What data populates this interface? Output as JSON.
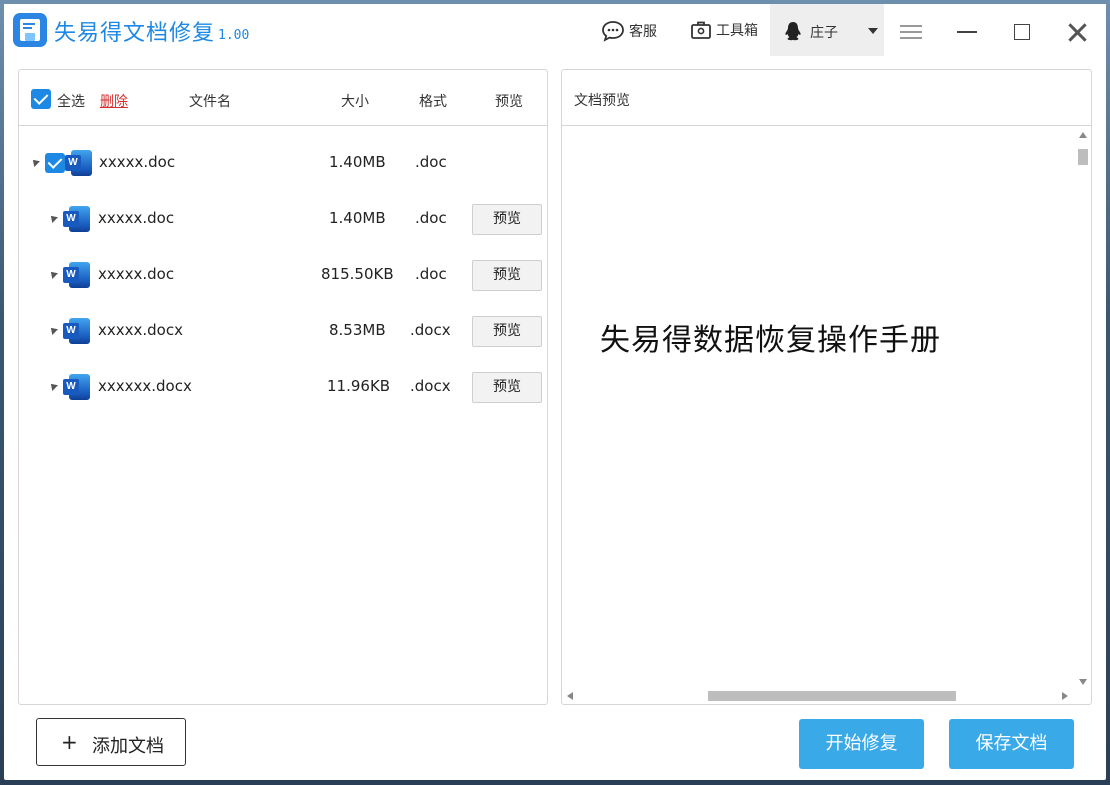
{
  "app": {
    "title": "失易得文档修复",
    "version": "1.00"
  },
  "titlebar": {
    "support_label": "客服",
    "toolbox_label": "工具箱",
    "user_name": "庄子"
  },
  "file_list": {
    "select_all_label": "全选",
    "delete_label": "删除",
    "columns": {
      "name": "文件名",
      "size": "大小",
      "format": "格式",
      "preview": "预览"
    },
    "rows": [
      {
        "name": "xxxxx.doc",
        "size": "1.40MB",
        "format": ".doc",
        "preview": "",
        "checked": true
      },
      {
        "name": "xxxxx.doc",
        "size": "1.40MB",
        "format": ".doc",
        "preview": "预览"
      },
      {
        "name": "xxxxx.doc",
        "size": "815.50KB",
        "format": ".doc",
        "preview": "预览"
      },
      {
        "name": "xxxxx.docx",
        "size": "8.53MB",
        "format": ".docx",
        "preview": "预览"
      },
      {
        "name": "xxxxxx.docx",
        "size": "11.96KB",
        "format": ".docx",
        "preview": "预览"
      }
    ]
  },
  "preview_panel": {
    "title": "文档预览",
    "document_heading": "失易得数据恢复操作手册"
  },
  "footer": {
    "add_button": "添加文档",
    "start_repair_button": "开始修复",
    "save_button": "保存文档"
  },
  "colors": {
    "accent": "#1e88e5",
    "primary_button": "#3aa9e8",
    "delete": "#d32f2f"
  },
  "icons": {
    "app_logo": "document-logo-icon",
    "support": "chat-bubble-icon",
    "toolbox": "toolbox-icon",
    "user": "qq-penguin-icon",
    "file": "word-doc-icon"
  }
}
